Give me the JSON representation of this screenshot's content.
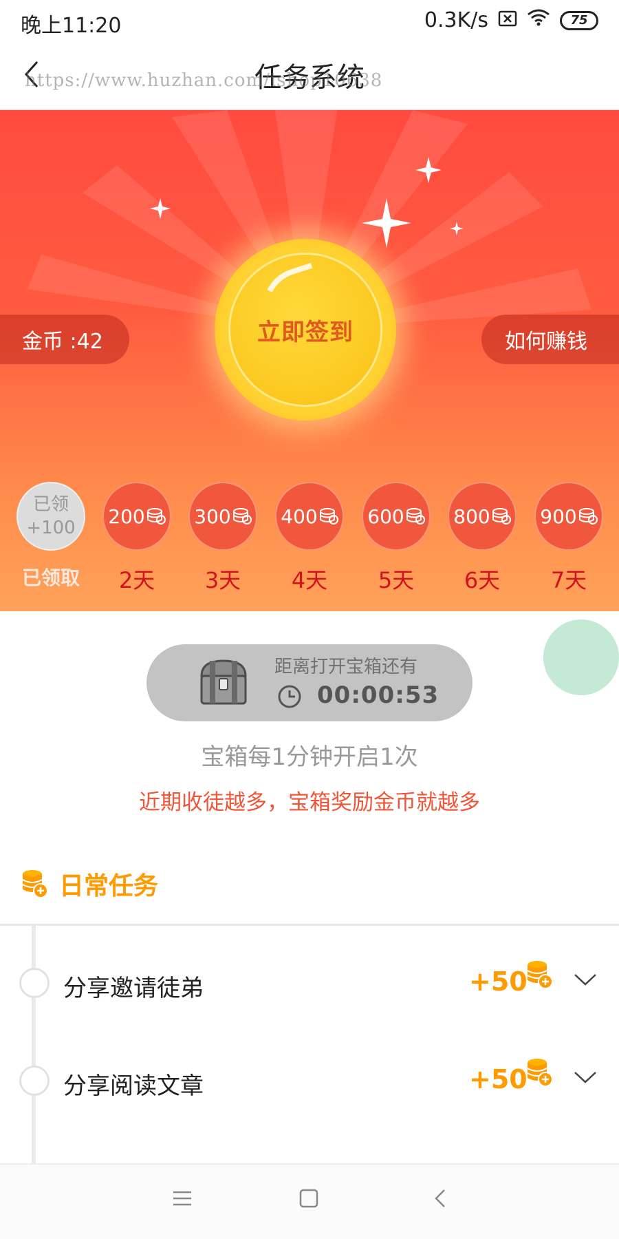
{
  "status_bar": {
    "time": "晚上11:20",
    "network_speed": "0.3K/s",
    "battery": "75"
  },
  "header": {
    "title": "任务系统",
    "watermark": "https://www.huzhan.com/ishop10638"
  },
  "hero": {
    "coins_label": "金币 :42",
    "how_to_earn": "如何赚钱",
    "checkin_button": "立即签到",
    "days": [
      {
        "line1": "已领",
        "line2": "+100",
        "label": "已领取",
        "claimed": true
      },
      {
        "amount": "200",
        "label": "2天"
      },
      {
        "amount": "300",
        "label": "3天"
      },
      {
        "amount": "400",
        "label": "4天"
      },
      {
        "amount": "600",
        "label": "5天"
      },
      {
        "amount": "800",
        "label": "6天"
      },
      {
        "amount": "900",
        "label": "7天"
      }
    ]
  },
  "chest": {
    "caption": "距离打开宝箱还有",
    "countdown": "00:00:53",
    "note": "宝箱每1分钟开启1次",
    "promo": "近期收徒越多，宝箱奖励金币就越多"
  },
  "daily_tasks": {
    "title": "日常任务",
    "items": [
      {
        "name": "分享邀请徒弟",
        "reward": "+50"
      },
      {
        "name": "分享阅读文章",
        "reward": "+50"
      }
    ]
  },
  "colors": {
    "accent_orange": "#ff9a00",
    "hero_red": "#ff4b3f",
    "day_label_red": "#d4121e",
    "promo_red": "#f05537"
  }
}
